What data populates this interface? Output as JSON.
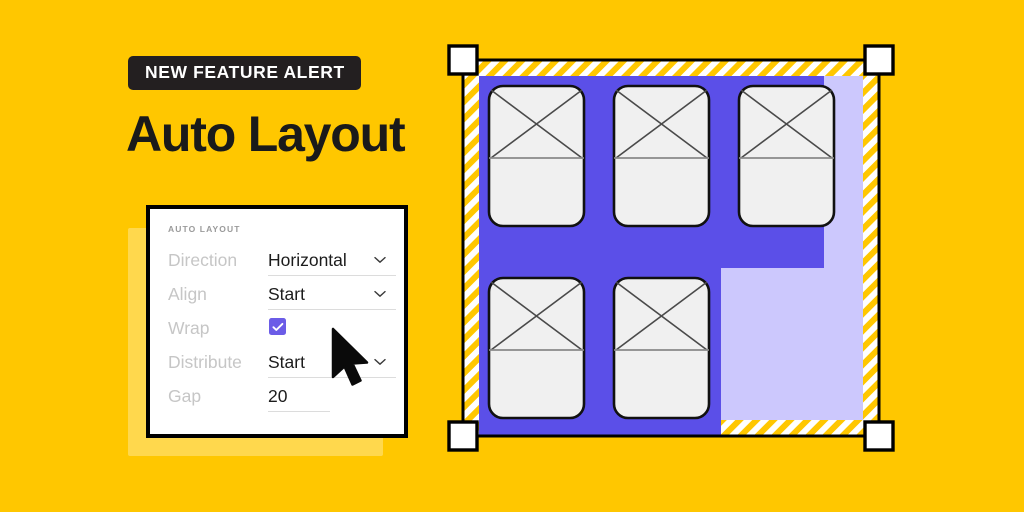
{
  "page": {
    "background_color": "#FFC700",
    "title": "Auto Layout"
  },
  "badge": {
    "label": "NEW FEATURE ALERT",
    "background_color": "#231F20",
    "text_color": "#FFFFFF"
  },
  "headline": {
    "text": "Auto Layout",
    "color": "#1A1A1A"
  },
  "panel": {
    "title": "AUTO LAYOUT",
    "border_color": "#000000",
    "background_color": "#FFFFFF",
    "shadow_color": "#FFD84D",
    "label_color": "#C6C6C6",
    "value_color": "#1C1C1C",
    "accent_color": "#6B5CE7",
    "fields": [
      {
        "label": "Direction",
        "value": "Horizontal",
        "control": "select",
        "icon": "chevron-down-icon"
      },
      {
        "label": "Align",
        "value": "Start",
        "control": "select",
        "icon": "chevron-down-icon"
      },
      {
        "label": "Wrap",
        "value": "",
        "control": "checkbox",
        "checked": true,
        "icon": "check-icon"
      },
      {
        "label": "Distribute",
        "value": "Start",
        "control": "select",
        "icon": "chevron-down-icon"
      },
      {
        "label": "Gap",
        "value": "20",
        "control": "number",
        "icon": ""
      }
    ]
  },
  "cursor": {
    "icon": "arrow-pointer-icon",
    "color": "#000000"
  },
  "canvas": {
    "frame_fill_color": "#CCC8FD",
    "gap_bar_color": "#5B4FE8",
    "padding_stripe_color": "#FFC700",
    "padding_stripe_alt_color": "#FFFFFF",
    "card_fill_color": "#F0F0F0",
    "card_stroke_color": "#111111",
    "handle_fill_color": "#FFFFFF",
    "handle_stroke_color": "#000000",
    "selection_handles": [
      {
        "position": "top-left"
      },
      {
        "position": "top-right"
      },
      {
        "position": "bottom-left"
      },
      {
        "position": "bottom-right"
      }
    ],
    "cards": [
      {
        "row": 1,
        "col": 1,
        "placeholder": "image-placeholder"
      },
      {
        "row": 1,
        "col": 2,
        "placeholder": "image-placeholder"
      },
      {
        "row": 1,
        "col": 3,
        "placeholder": "image-placeholder"
      },
      {
        "row": 2,
        "col": 1,
        "placeholder": "image-placeholder"
      },
      {
        "row": 2,
        "col": 2,
        "placeholder": "image-placeholder"
      }
    ]
  }
}
